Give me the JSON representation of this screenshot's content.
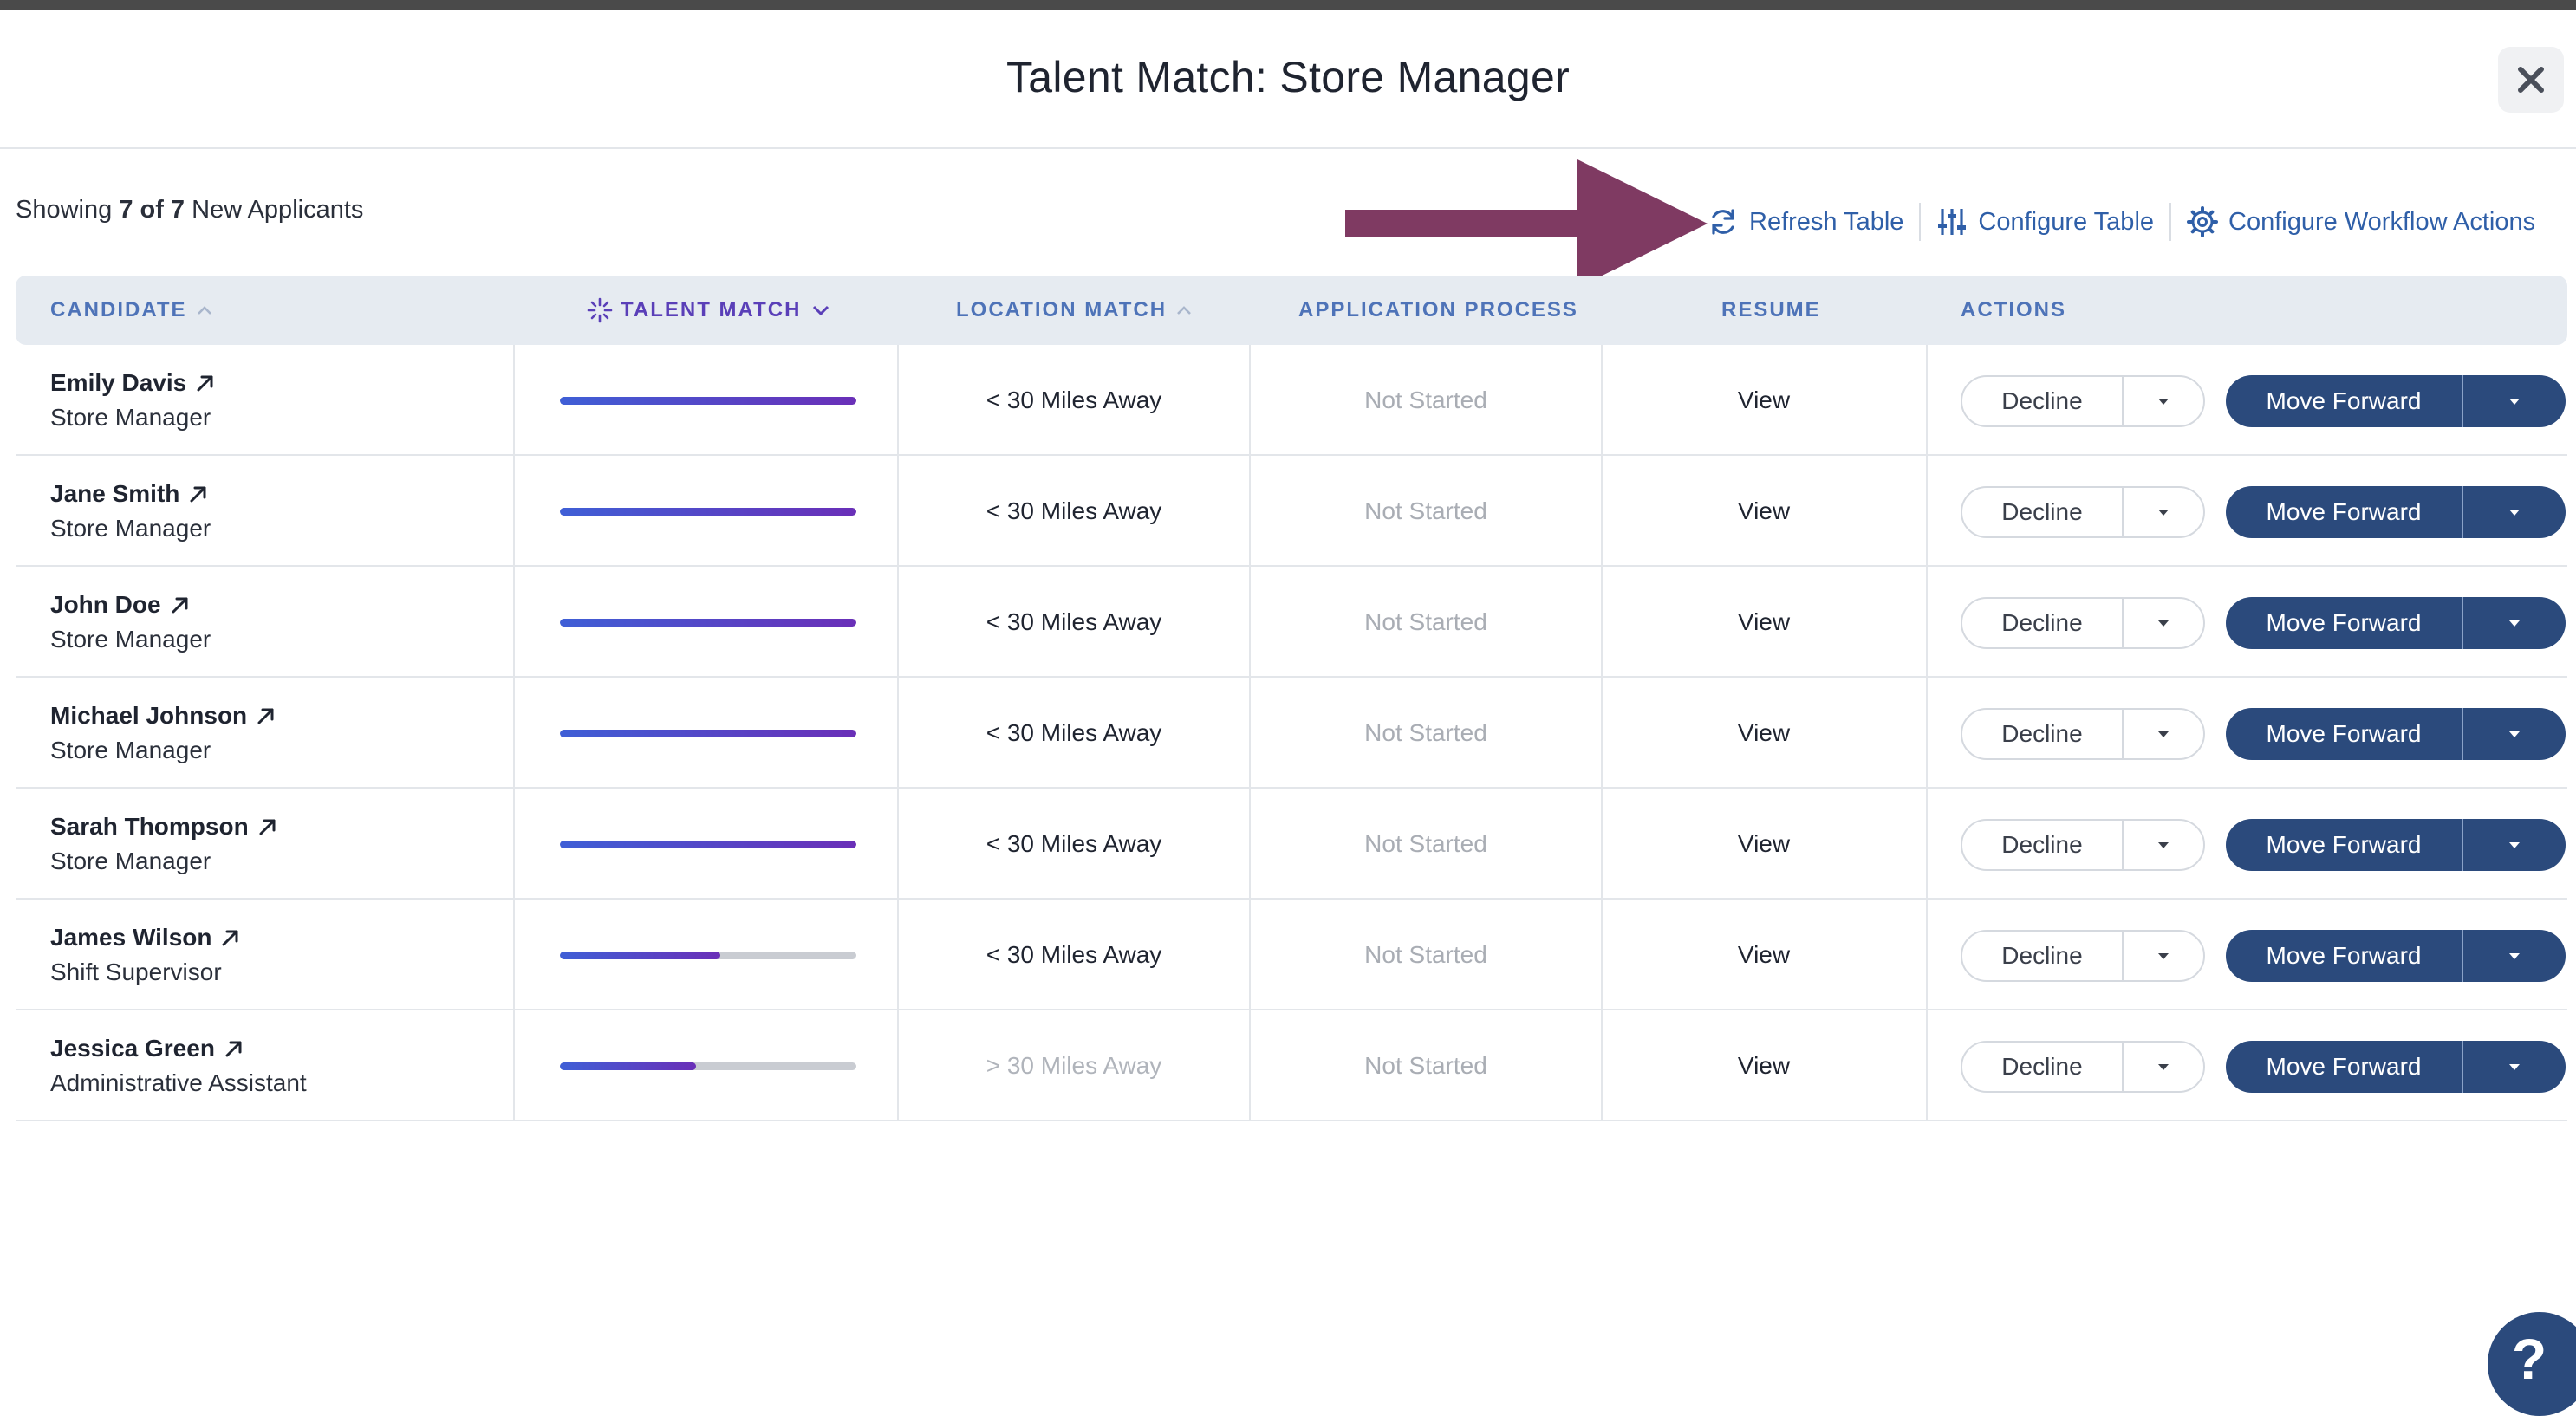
{
  "modal": {
    "title": "Talent Match: Store Manager",
    "close_icon": "close-icon"
  },
  "summary": {
    "prefix": "Showing ",
    "count": "7 of 7",
    "suffix": " New Applicants"
  },
  "toolbar": {
    "refresh": "Refresh Table",
    "configure_table": "Configure Table",
    "configure_workflow": "Configure Workflow Actions"
  },
  "columns": {
    "candidate": "CANDIDATE",
    "talent_match": "TALENT MATCH",
    "location_match": "LOCATION MATCH",
    "application_process": "APPLICATION PROCESS",
    "resume": "RESUME",
    "actions": "ACTIONS"
  },
  "rows": [
    {
      "name": "Emily Davis",
      "role": "Store Manager",
      "match": 1.0,
      "location": "< 30 Miles Away",
      "location_far": false,
      "process": "Not Started",
      "resume": "View",
      "decline": "Decline",
      "forward": "Move Forward"
    },
    {
      "name": "Jane Smith",
      "role": "Store Manager",
      "match": 1.0,
      "location": "< 30 Miles Away",
      "location_far": false,
      "process": "Not Started",
      "resume": "View",
      "decline": "Decline",
      "forward": "Move Forward"
    },
    {
      "name": "John Doe",
      "role": "Store Manager",
      "match": 1.0,
      "location": "< 30 Miles Away",
      "location_far": false,
      "process": "Not Started",
      "resume": "View",
      "decline": "Decline",
      "forward": "Move Forward"
    },
    {
      "name": "Michael Johnson",
      "role": "Store Manager",
      "match": 1.0,
      "location": "< 30 Miles Away",
      "location_far": false,
      "process": "Not Started",
      "resume": "View",
      "decline": "Decline",
      "forward": "Move Forward"
    },
    {
      "name": "Sarah Thompson",
      "role": "Store Manager",
      "match": 1.0,
      "location": "< 30 Miles Away",
      "location_far": false,
      "process": "Not Started",
      "resume": "View",
      "decline": "Decline",
      "forward": "Move Forward"
    },
    {
      "name": "James Wilson",
      "role": "Shift Supervisor",
      "match": 0.54,
      "location": "< 30 Miles Away",
      "location_far": false,
      "process": "Not Started",
      "resume": "View",
      "decline": "Decline",
      "forward": "Move Forward"
    },
    {
      "name": "Jessica Green",
      "role": "Administrative Assistant",
      "match": 0.46,
      "location": "> 30 Miles Away",
      "location_far": true,
      "process": "Not Started",
      "resume": "View",
      "decline": "Decline",
      "forward": "Move Forward"
    }
  ],
  "help": {
    "label": "?"
  },
  "colors": {
    "accent_link": "#2f5fa8",
    "primary_button": "#2b4a7c",
    "annotation_arrow": "#7f3a62",
    "talent_gradient_start": "#3f5fd6",
    "talent_gradient_end": "#6a2fb8"
  }
}
